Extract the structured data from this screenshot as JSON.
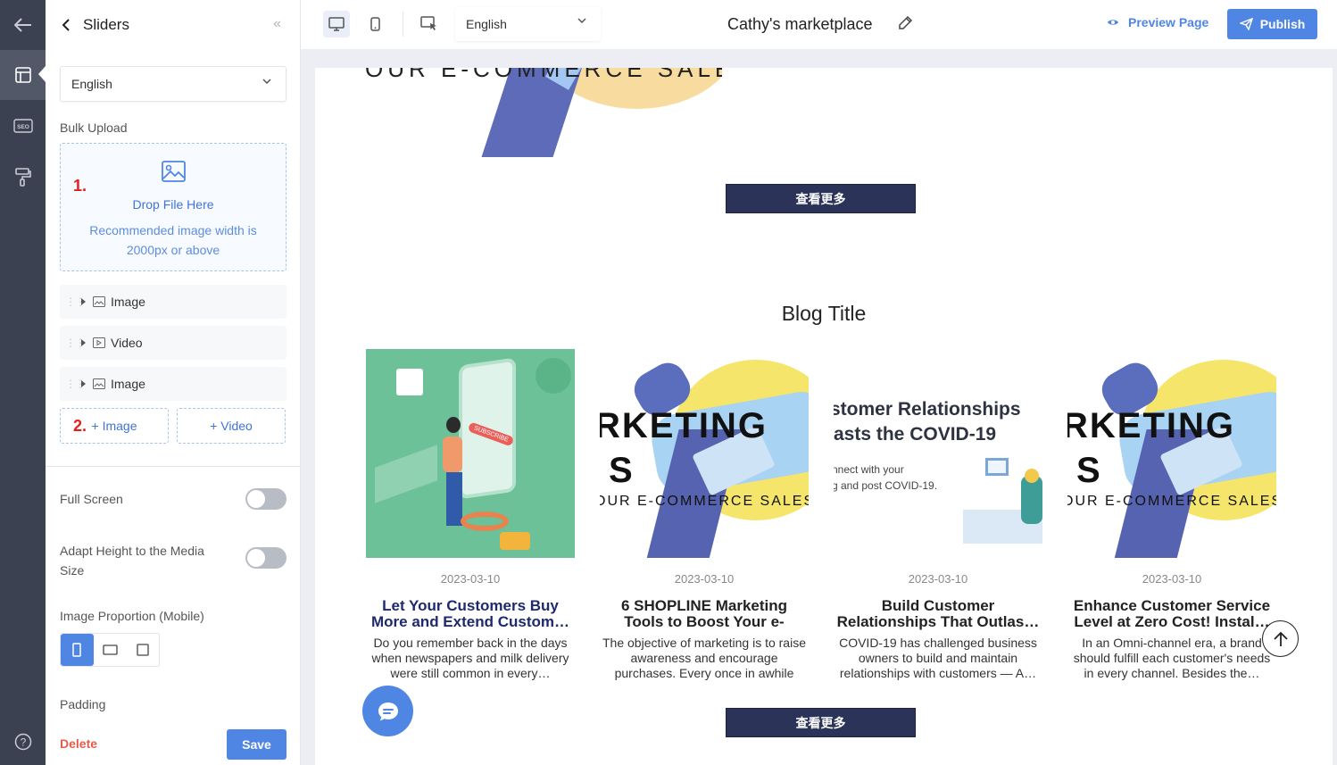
{
  "panel": {
    "title": "Sliders",
    "language": "English",
    "bulk_upload_label": "Bulk Upload",
    "drop_main": "Drop File Here",
    "drop_hint": "Recommended image width is 2000px or above",
    "step1": "1.",
    "step2": "2.",
    "items": [
      {
        "label": "Image",
        "icon": "image-icon"
      },
      {
        "label": "Video",
        "icon": "video-icon"
      },
      {
        "label": "Image",
        "icon": "image-icon"
      }
    ],
    "add_image": "+ Image",
    "add_video": "+ Video",
    "full_screen_label": "Full Screen",
    "full_screen_on": false,
    "adapt_height_label": "Adapt Height to the Media Size",
    "adapt_height_on": false,
    "proportion_label": "Image Proportion (Mobile)",
    "proportion_selected": "portrait",
    "padding_label": "Padding",
    "delete_label": "Delete",
    "save_label": "Save"
  },
  "toolbar": {
    "language": "English",
    "store_name": "Cathy's marketplace",
    "preview_label": "Preview Page",
    "publish_label": "Publish"
  },
  "page": {
    "hero_text_fragment": "OUR E-COMMERCE SALES",
    "more_button_1": "查看更多",
    "blog_title": "Blog Title",
    "more_button_2": "查看更多",
    "posts": [
      {
        "date": "2023-03-10",
        "title": "Let Your Customers Buy More and Extend Custom…",
        "desc": "Do you remember back in the days when newspapers and milk delivery were still common in every…",
        "thumb": "subscribe-illustration",
        "thumb_text": "SUBSCRIBE"
      },
      {
        "date": "2023-03-10",
        "title": "6 SHOPLINE Marketing Tools to Boost Your e-Commerc…",
        "desc": "The objective of marketing is to raise awareness and encourage purchases. Every once in awhile brands woul…",
        "thumb": "marketing-illustration",
        "thumb_big": "RKETING",
        "thumb_big2": "S",
        "thumb_small": "OUR E-COMMERCE SALES"
      },
      {
        "date": "2023-03-10",
        "title": "Build Customer Relationships That Outlas…",
        "desc": "COVID-19 has challenged business owners to build and maintain relationships with customers — A…",
        "thumb": "covid-relationship-illustration",
        "thumb_big": "stomer Relationships",
        "thumb_big2": "asts the COVID-19",
        "thumb_small": "nnect with your",
        "thumb_small2": "g and post COVID-19."
      },
      {
        "date": "2023-03-10",
        "title": "Enhance Customer Service Level at Zero Cost! Instal…",
        "desc": "In an Omni-channel era, a brand should fulfill each customer's needs in every channel. Besides the…",
        "thumb": "marketing-illustration",
        "thumb_big": "RKETING",
        "thumb_big2": "S",
        "thumb_small": "OUR E-COMMERCE SALES"
      }
    ]
  },
  "colors": {
    "accent": "#4f86e4",
    "navy_button": "#2c3359",
    "rail": "#3b4150",
    "step_red": "#e02020"
  }
}
